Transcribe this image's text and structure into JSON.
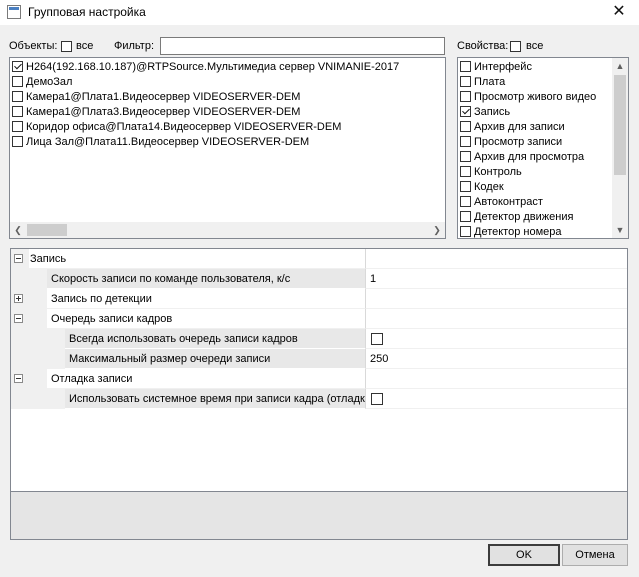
{
  "window": {
    "title": "Групповая настройка",
    "close_glyph": "✕"
  },
  "objects": {
    "label": "Объекты:",
    "all_label": "все",
    "all_checked": false,
    "filter_label": "Фильтр:",
    "filter_value": "",
    "items": [
      {
        "label": "H264(192.168.10.187)@RTPSource.Мультимедиа сервер VNIMANIE-2017",
        "checked": true
      },
      {
        "label": "ДемоЗал",
        "checked": false
      },
      {
        "label": "Камера1@Плата1.Видеосервер VIDEOSERVER-DEM",
        "checked": false
      },
      {
        "label": "Камера1@Плата3.Видеосервер VIDEOSERVER-DEM",
        "checked": false
      },
      {
        "label": "Коридор офиса@Плата14.Видеосервер VIDEOSERVER-DEM",
        "checked": false
      },
      {
        "label": "Лица Зал@Плата11.Видеосервер VIDEOSERVER-DEM",
        "checked": false
      }
    ]
  },
  "properties": {
    "label": "Свойства:",
    "all_label": "все",
    "all_checked": false,
    "items": [
      {
        "label": "Интерфейс",
        "checked": false
      },
      {
        "label": "Плата",
        "checked": false
      },
      {
        "label": "Просмотр живого видео",
        "checked": false
      },
      {
        "label": "Запись",
        "checked": true
      },
      {
        "label": "Архив для записи",
        "checked": false
      },
      {
        "label": "Просмотр записи",
        "checked": false
      },
      {
        "label": "Архив для просмотра",
        "checked": false
      },
      {
        "label": "Контроль",
        "checked": false
      },
      {
        "label": "Кодек",
        "checked": false
      },
      {
        "label": "Автоконтраст",
        "checked": false
      },
      {
        "label": "Детектор движения",
        "checked": false
      },
      {
        "label": "Детектор номера",
        "checked": false
      }
    ]
  },
  "grid": {
    "rows": [
      {
        "kind": "category",
        "level": 0,
        "label": "Запись",
        "expanded": true
      },
      {
        "kind": "property",
        "level": 1,
        "label": "Скорость записи по команде пользователя, к/с",
        "value": "1"
      },
      {
        "kind": "category",
        "level": 1,
        "label": "Запись по детекции",
        "expanded": false
      },
      {
        "kind": "category",
        "level": 1,
        "label": "Очередь записи кадров",
        "expanded": true
      },
      {
        "kind": "property",
        "level": 2,
        "label": "Всегда использовать очередь записи кадров",
        "value_checkbox": false
      },
      {
        "kind": "property",
        "level": 2,
        "label": "Максимальный размер очереди записи",
        "value": "250"
      },
      {
        "kind": "category",
        "level": 1,
        "label": "Отладка записи",
        "expanded": true
      },
      {
        "kind": "property",
        "level": 2,
        "label": "Использовать системное время при записи кадра (отладка ...",
        "value_checkbox": false
      }
    ]
  },
  "buttons": {
    "ok": "OK",
    "cancel": "Отмена"
  }
}
